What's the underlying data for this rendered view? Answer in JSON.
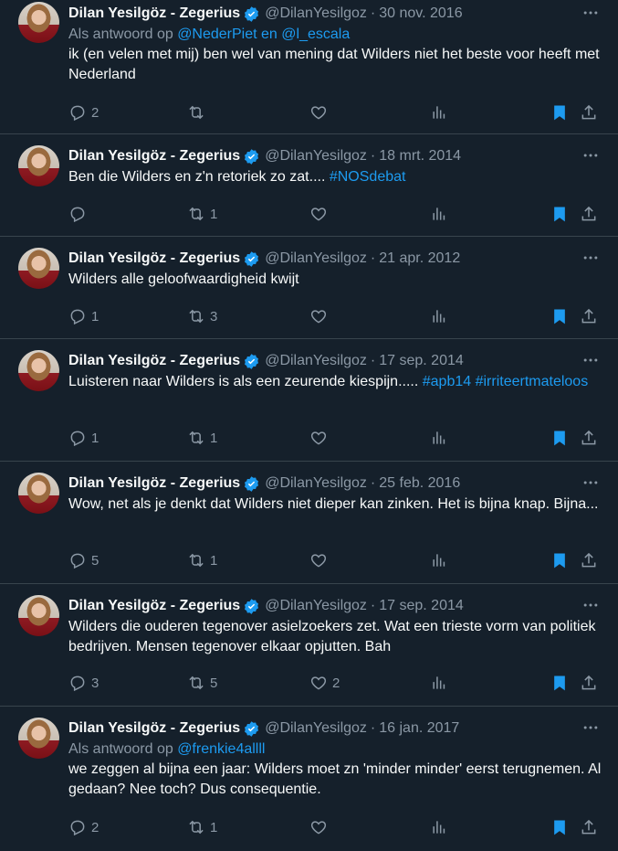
{
  "tweets": [
    {
      "name": "Dilan Yesilgöz - Zegerius",
      "handle": "@DilanYesilgoz",
      "date": "30 nov. 2016",
      "reply_prefix": "Als antwoord op",
      "reply_mentions": "@NederPiet en @l_escala",
      "text": "ik (en velen met mij) ben wel van mening dat Wilders niet het beste voor heeft met Nederland",
      "text_tags": "",
      "replies": "2",
      "retweets": "",
      "likes": ""
    },
    {
      "name": "Dilan Yesilgöz - Zegerius",
      "handle": "@DilanYesilgoz",
      "date": "18 mrt. 2014",
      "reply_prefix": "",
      "reply_mentions": "",
      "text": "Ben die Wilders en z'n retoriek zo zat.... ",
      "text_tags": " #NOSdebat",
      "replies": "",
      "retweets": "1",
      "likes": ""
    },
    {
      "name": "Dilan Yesilgöz - Zegerius",
      "handle": "@DilanYesilgoz",
      "date": "21 apr. 2012",
      "reply_prefix": "",
      "reply_mentions": "",
      "text": "Wilders alle geloofwaardigheid kwijt",
      "text_tags": "",
      "replies": "1",
      "retweets": "3",
      "likes": ""
    },
    {
      "name": "Dilan Yesilgöz - Zegerius",
      "handle": "@DilanYesilgoz",
      "date": "17 sep. 2014",
      "reply_prefix": "",
      "reply_mentions": "",
      "text": "Luisteren naar Wilders is als een zeurende kiespijn..... ",
      "text_tags": "#apb14 #irriteertmateloos",
      "replies": "1",
      "retweets": "1",
      "likes": ""
    },
    {
      "name": "Dilan Yesilgöz - Zegerius",
      "handle": "@DilanYesilgoz",
      "date": "25 feb. 2016",
      "reply_prefix": "",
      "reply_mentions": "",
      "text": "Wow, net als je denkt dat Wilders niet dieper kan zinken. Het is bijna knap. Bijna...",
      "text_tags": "",
      "replies": "5",
      "retweets": "1",
      "likes": ""
    },
    {
      "name": "Dilan Yesilgöz - Zegerius",
      "handle": "@DilanYesilgoz",
      "date": "17 sep. 2014",
      "reply_prefix": "",
      "reply_mentions": "",
      "text": "Wilders die ouderen tegenover asielzoekers zet. Wat een trieste vorm van politiek bedrijven. Mensen tegenover elkaar opjutten. Bah",
      "text_tags": "",
      "replies": "3",
      "retweets": "5",
      "likes": "2"
    },
    {
      "name": "Dilan Yesilgöz - Zegerius",
      "handle": "@DilanYesilgoz",
      "date": "16 jan. 2017",
      "reply_prefix": "Als antwoord op",
      "reply_mentions": "@frenkie4allll",
      "text": "we zeggen al bijna een jaar: Wilders moet zn 'minder minder' eerst terugnemen. Al gedaan? Nee toch? Dus consequentie.",
      "text_tags": "",
      "replies": "2",
      "retweets": "1",
      "likes": ""
    }
  ],
  "colors": {
    "background": "#15202b",
    "text": "#f7f9f9",
    "muted": "#8b98a5",
    "accent": "#1d9bf0",
    "divider": "#38444d"
  }
}
